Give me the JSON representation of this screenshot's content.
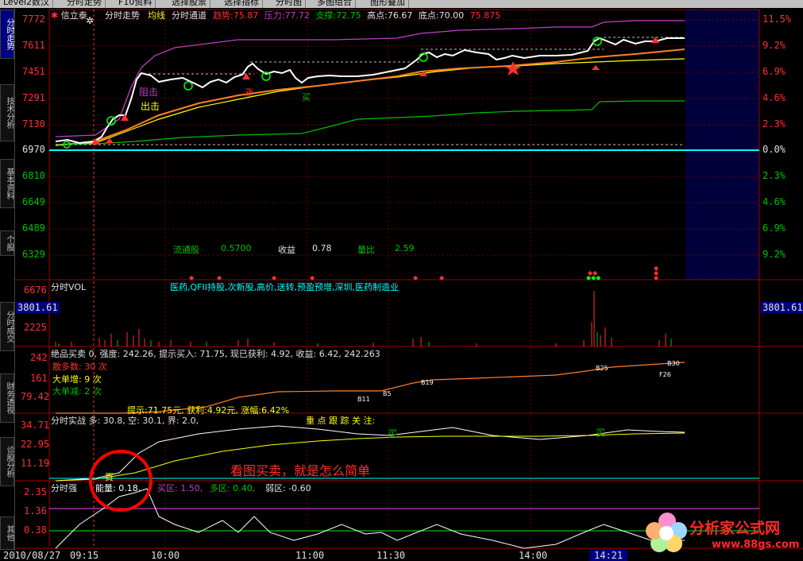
{
  "toolbar": {
    "items": [
      "Level2数汉",
      "分时走势",
      "F10资料",
      "选择股票",
      "选择指标",
      "分时图",
      "多图组合",
      "图形叠加"
    ]
  },
  "sidebar": {
    "tabs": [
      "分时走势",
      "技术分析",
      "基本资料",
      "个股",
      "分时成交",
      "财务透视",
      "诊股分析",
      "其他"
    ]
  },
  "price_panel": {
    "stock_name": "信立泰",
    "mode": "分时走势",
    "line_name": "均线",
    "indicator": "分时通道",
    "trend_label": "趋势:",
    "trend_value": "75.87",
    "pressure_label": "压力:",
    "pressure_value": "77.72",
    "support_label": "支撑:",
    "support_value": "72.75",
    "high_label": "高点:",
    "high_value": "76.67",
    "low_label": "底点:",
    "low_value": "70.00",
    "extra_value": "75.875",
    "left_axis": [
      "7772",
      "7611",
      "7451",
      "7291",
      "7130",
      "6970",
      "6810",
      "6649",
      "6489",
      "6329"
    ],
    "right_axis": [
      "11.5%",
      "9.2%",
      "6.9%",
      "4.6%",
      "2.3%",
      "0.0%",
      "2.3%",
      "4.6%",
      "6.9%",
      "9.2%"
    ],
    "annotations": {
      "zuji": "阻击",
      "chuji": "出击",
      "zhang": "涨",
      "mai": "买"
    },
    "info": {
      "float_label": "流通股",
      "float_value": "0.5700",
      "eps_label": "收益",
      "eps_value": "0.78",
      "ratio_label": "量比",
      "ratio_value": "2.59"
    }
  },
  "vol_panel": {
    "title": "分时VOL",
    "tags": "医药,QFII持股,次新股,高价,送转,预盈预增,深圳,医药制造业",
    "left_axis": [
      "6676",
      "3801.61",
      "2225"
    ],
    "right_value": "3801.61"
  },
  "signal_panel": {
    "header": "绝品买卖 0, 强度: 242.26, 提示买入: 71.75, 现已获利: 4.92, 收益: 6.42, 242.263",
    "left_axis": [
      "242",
      "161",
      "79.42"
    ],
    "count_rows": [
      "散多数: 30 次",
      "大单增: 9 次",
      "大单减: 2 次"
    ],
    "marks": [
      "B11",
      "B5",
      "B19",
      "B25",
      "B30",
      "F26"
    ],
    "bottom_text": "提示:71.75元, 获利:4.92元, 涨幅:6.42%"
  },
  "battle_panel": {
    "header": "分时实战 多: 30.8, 空: 30.1, 界: 2.0,",
    "focus": "重 点 跟 踪 关 注:",
    "left_axis": [
      "34.71",
      "22.95",
      "11.19"
    ],
    "buy1": "买",
    "buy2": "买",
    "caption": "看图买卖，就是怎么简单"
  },
  "strength_panel": {
    "header_title": "分时强",
    "energy": "能量: 0.18,",
    "buy_zone": "买区: 1.50,",
    "multi_zone": "多区: 0.40,",
    "weak_zone": "弱区: -0.60",
    "left_axis": [
      "2.35",
      "1.36",
      "0.38"
    ],
    "badge": "買"
  },
  "time_axis": [
    "2010/08/27",
    "09:15",
    "10:00",
    "11:00",
    "11:30",
    "14:00",
    "14:21"
  ],
  "watermark": {
    "cn": "分析家公式网",
    "url": "www.88gs.com"
  },
  "colors": {
    "up": "#ff3030",
    "down": "#00c000",
    "grid": "#a00000",
    "price_line": "#ffffff",
    "avg_line": "#ffff00",
    "channel_top": "#c040c0",
    "orange": "#ff7f27",
    "baseline": "#00ffff"
  }
}
